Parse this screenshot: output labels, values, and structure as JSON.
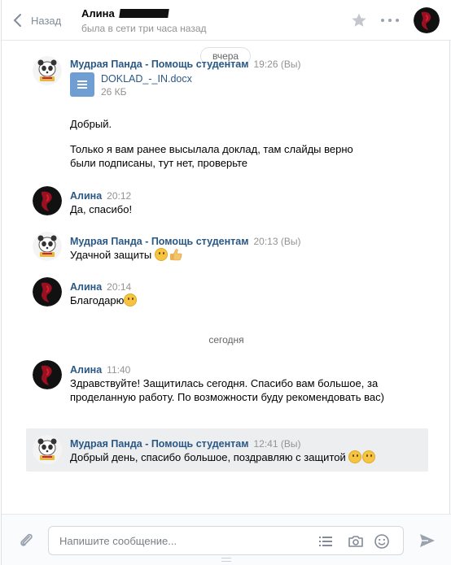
{
  "header": {
    "back_label": "Назад",
    "peer_name": "Алина",
    "peer_status": "была в сети три часа назад"
  },
  "history": {
    "day_yesterday": "вчера",
    "day_today": "сегодня",
    "messages": [
      {
        "author": "Мудрая Панда - Помощь студентам",
        "time": "19:26 (Вы)",
        "attachment": {
          "name": "DOKLAD_-_IN.docx",
          "size": "26 КБ"
        },
        "text1": "Добрый.",
        "text2": "Только я вам ранее высылала доклад, там слайды верно были подписаны, тут нет, проверьте"
      },
      {
        "author": "Алина",
        "time": "20:12",
        "text": "Да, спасибо!"
      },
      {
        "author": "Мудрая Панда - Помощь студентам",
        "time": "20:13 (Вы)",
        "text": "Удачной защиты"
      },
      {
        "author": "Алина",
        "time": "20:14",
        "text": "Благодарю"
      },
      {
        "author": "Алина",
        "time": "11:40",
        "text": "Здравствуйте! Защитилась сегодня. Спасибо вам большое, за проделанную работу. По возможности буду рекомендовать вас)"
      },
      {
        "author": "Мудрая Панда - Помощь студентам",
        "time": "12:41 (Вы)",
        "text": "Добрый день, спасибо большое, поздравляю с защитой"
      }
    ]
  },
  "composer": {
    "placeholder": "Напишите сообщение..."
  },
  "icons": [
    "back-chevron-icon",
    "star-icon",
    "more-icon",
    "paperclip-icon",
    "list-icon",
    "camera-icon",
    "smile-icon",
    "send-icon",
    "document-icon"
  ],
  "colors": {
    "link": "#2a5885",
    "muted": "#939393",
    "doc": "#6f9ed3",
    "selected_bg": "#edeef0"
  }
}
